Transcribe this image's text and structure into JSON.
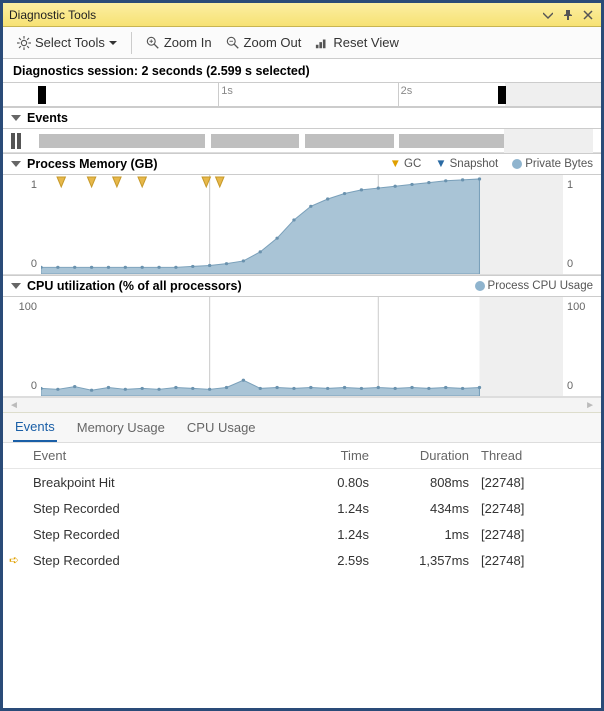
{
  "window": {
    "title": "Diagnostic Tools"
  },
  "toolbar": {
    "select_tools": "Select Tools",
    "zoom_in": "Zoom In",
    "zoom_out": "Zoom Out",
    "reset_view": "Reset View"
  },
  "session": {
    "label": "Diagnostics session: 2 seconds (2.599 s selected)"
  },
  "timeline": {
    "ticks": [
      {
        "pos_pct": 36,
        "label": "1s"
      },
      {
        "pos_pct": 66,
        "label": "2s"
      }
    ],
    "handle_start_pct": 6.5,
    "handle_end_pct": 83.5,
    "domain_end_pct": 84
  },
  "sections": {
    "events": {
      "title": "Events"
    },
    "memory": {
      "title": "Process Memory (GB)",
      "legend": [
        {
          "icon": "gc",
          "label": "GC"
        },
        {
          "icon": "snapshot",
          "label": "Snapshot"
        },
        {
          "icon": "private",
          "label": "Private Bytes"
        }
      ],
      "y_max": "1",
      "y_min": "0"
    },
    "cpu": {
      "title": "CPU utilization (% of all processors)",
      "legend": [
        {
          "icon": "process",
          "label": "Process CPU Usage"
        }
      ],
      "y_max": "100",
      "y_min": "0"
    }
  },
  "tabs": {
    "items": [
      "Events",
      "Memory Usage",
      "CPU Usage"
    ],
    "active_index": 0
  },
  "grid": {
    "columns": [
      "Event",
      "Time",
      "Duration",
      "Thread"
    ],
    "rows": [
      {
        "current": false,
        "event": "Breakpoint Hit",
        "time": "0.80s",
        "duration": "808ms",
        "thread": "[22748]"
      },
      {
        "current": false,
        "event": "Step Recorded",
        "time": "1.24s",
        "duration": "434ms",
        "thread": "[22748]"
      },
      {
        "current": false,
        "event": "Step Recorded",
        "time": "1.24s",
        "duration": "1ms",
        "thread": "[22748]"
      },
      {
        "current": true,
        "event": "Step Recorded",
        "time": "2.59s",
        "duration": "1,357ms",
        "thread": "[22748]"
      }
    ]
  },
  "chart_data": [
    {
      "type": "area",
      "title": "Process Memory (GB)",
      "ylabel": "GB",
      "ylim": [
        0,
        1
      ],
      "x": [
        0.0,
        0.1,
        0.2,
        0.3,
        0.4,
        0.5,
        0.6,
        0.7,
        0.8,
        0.9,
        1.0,
        1.1,
        1.2,
        1.3,
        1.4,
        1.5,
        1.6,
        1.7,
        1.8,
        1.9,
        2.0,
        2.1,
        2.2,
        2.3,
        2.4,
        2.5,
        2.6
      ],
      "series": [
        {
          "name": "Private Bytes",
          "values": [
            0.03,
            0.03,
            0.03,
            0.03,
            0.03,
            0.03,
            0.03,
            0.03,
            0.03,
            0.04,
            0.05,
            0.07,
            0.1,
            0.2,
            0.35,
            0.55,
            0.7,
            0.78,
            0.84,
            0.88,
            0.9,
            0.92,
            0.94,
            0.96,
            0.98,
            0.99,
            1.0
          ]
        }
      ],
      "markers": {
        "GC": [
          0.12,
          0.3,
          0.45,
          0.6,
          0.98,
          1.06
        ]
      }
    },
    {
      "type": "area",
      "title": "CPU utilization (% of all processors)",
      "ylabel": "%",
      "ylim": [
        0,
        100
      ],
      "x": [
        0.0,
        0.1,
        0.2,
        0.3,
        0.4,
        0.5,
        0.6,
        0.7,
        0.8,
        0.9,
        1.0,
        1.1,
        1.2,
        1.3,
        1.4,
        1.5,
        1.6,
        1.7,
        1.8,
        1.9,
        2.0,
        2.1,
        2.2,
        2.3,
        2.4,
        2.5,
        2.6
      ],
      "series": [
        {
          "name": "Process CPU Usage",
          "values": [
            4,
            3,
            6,
            2,
            5,
            3,
            4,
            3,
            5,
            4,
            3,
            5,
            13,
            4,
            5,
            4,
            5,
            4,
            5,
            4,
            5,
            4,
            5,
            4,
            5,
            4,
            5
          ]
        }
      ]
    }
  ]
}
